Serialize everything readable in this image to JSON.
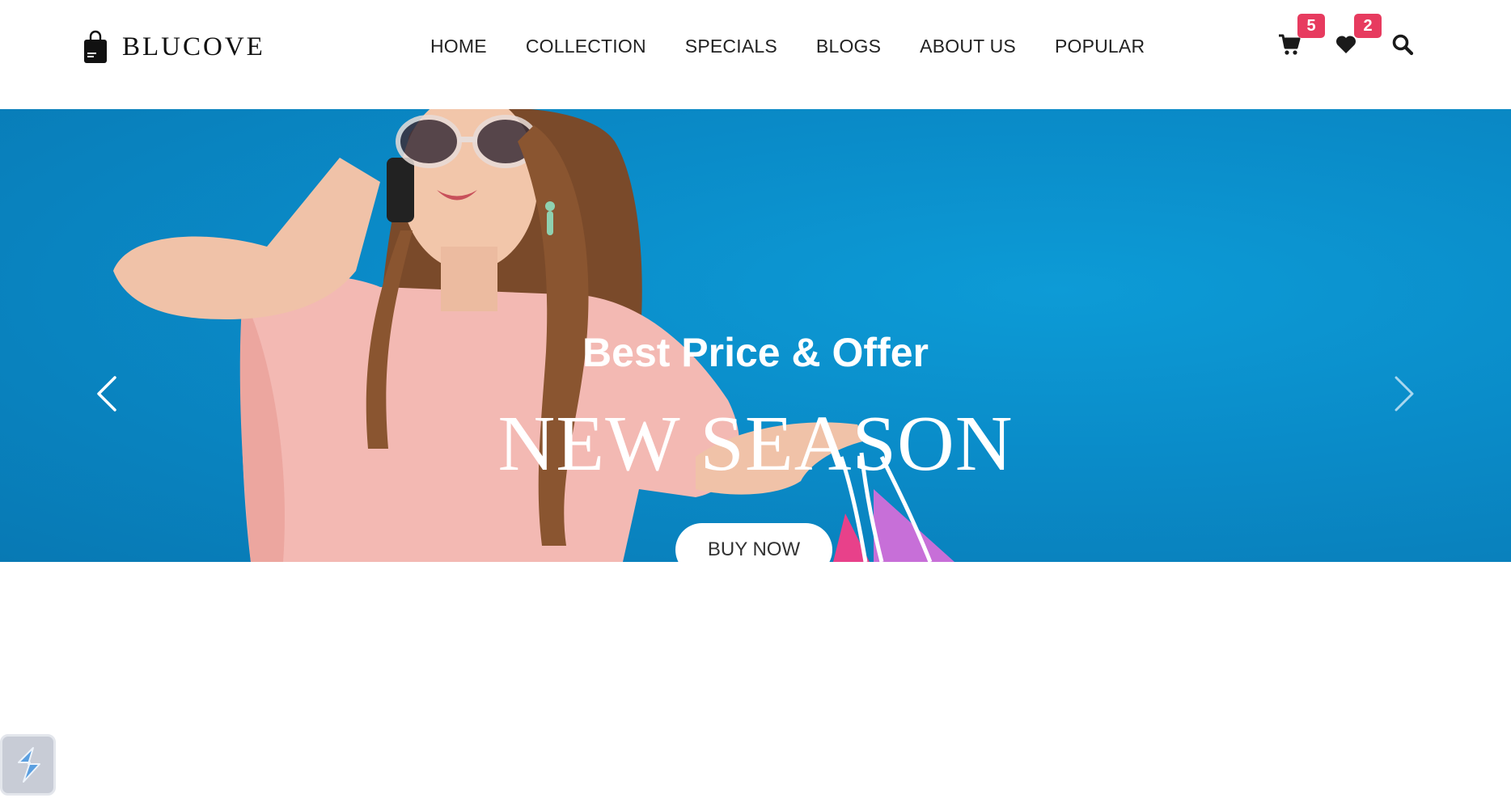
{
  "brand": {
    "name": "BLUCOVE",
    "logo_icon": "shopping-bag-icon"
  },
  "nav": {
    "items": [
      {
        "label": "HOME"
      },
      {
        "label": "COLLECTION"
      },
      {
        "label": "SPECIALS"
      },
      {
        "label": "BLOGS"
      },
      {
        "label": "ABOUT US"
      },
      {
        "label": "POPULAR"
      }
    ]
  },
  "actions": {
    "cart": {
      "icon": "cart-icon",
      "count": "5"
    },
    "wishlist": {
      "icon": "heart-icon",
      "count": "2"
    },
    "search": {
      "icon": "search-icon"
    }
  },
  "hero": {
    "subtitle": "Best Price & Offer",
    "title": "NEW SEASON",
    "button_label": "BUY NOW",
    "prev_icon": "chevron-left-icon",
    "next_icon": "chevron-right-icon"
  },
  "widget": {
    "icon": "app-widget-icon"
  },
  "colors": {
    "hero_background": "#0a8bc8",
    "badge": "#e73b5f",
    "text": "#222222"
  }
}
